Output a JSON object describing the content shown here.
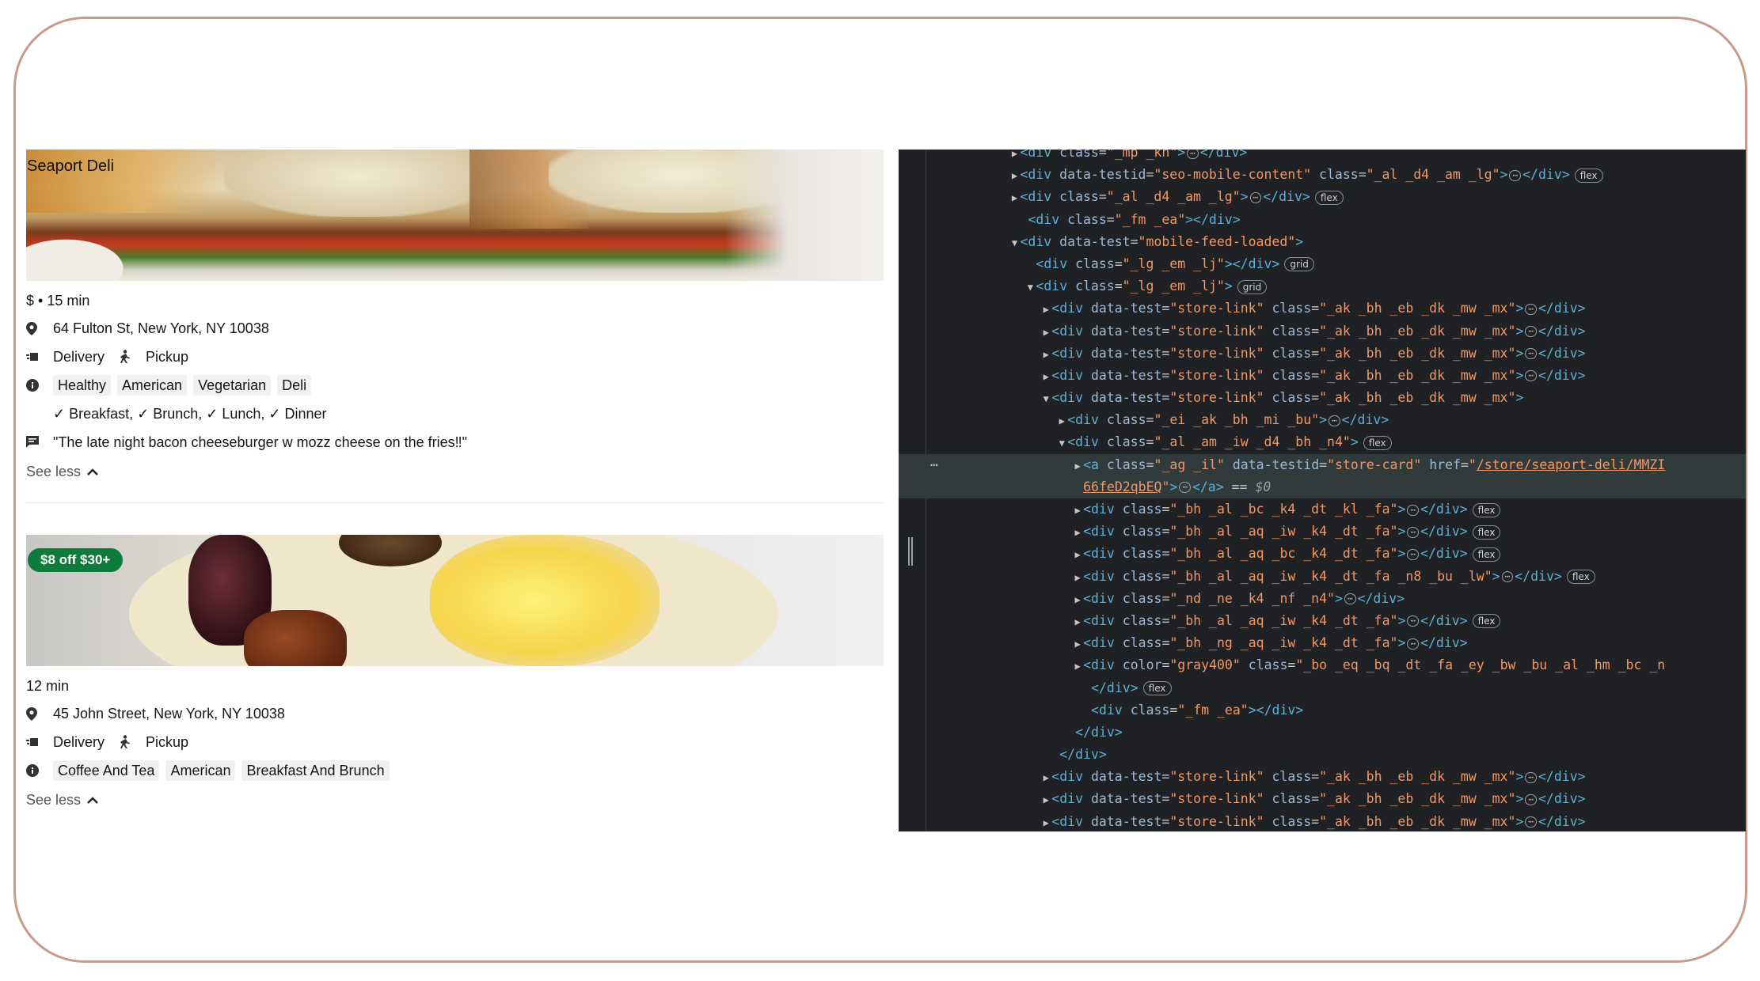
{
  "stores": [
    {
      "hero_title": "Seaport Deli",
      "promo": "",
      "meta": "$ • 15 min",
      "address": "64 Fulton St, New York, NY 10038",
      "delivery_label": "Delivery",
      "pickup_label": "Pickup",
      "tags": [
        "Healthy",
        "American",
        "Vegetarian",
        "Deli"
      ],
      "meals": "✓ Breakfast, ✓ Brunch, ✓ Lunch, ✓ Dinner",
      "review": "\"The late night bacon cheeseburger w mozz cheese on the fries‼\"",
      "see_less": "See less"
    },
    {
      "hero_title": "",
      "promo": "$8 off $30+",
      "meta": "12 min",
      "address": "45 John Street, New York, NY 10038",
      "delivery_label": "Delivery",
      "pickup_label": "Pickup",
      "tags": [
        "Coffee And Tea",
        "American",
        "Breakfast And Brunch"
      ],
      "see_less": "See less"
    }
  ],
  "devtools": {
    "lines": [
      {
        "indent": 10,
        "toggle": "▶",
        "parts": [
          [
            "tag",
            "<div "
          ],
          [
            "an",
            "class"
          ],
          [
            "eq",
            "="
          ],
          [
            "av",
            "\"_mp _kn\""
          ],
          [
            "tag",
            ">"
          ],
          [
            "ell",
            "⋯"
          ],
          [
            "tag",
            "</div>"
          ]
        ]
      },
      {
        "indent": 10,
        "toggle": "▶",
        "parts": [
          [
            "tag",
            "<div "
          ],
          [
            "an",
            "data-testid"
          ],
          [
            "eq",
            "="
          ],
          [
            "av",
            "\"seo-mobile-content\""
          ],
          [
            "tag",
            " "
          ],
          [
            "an",
            "class"
          ],
          [
            "eq",
            "="
          ],
          [
            "av",
            "\"_al _d4 _am _lg\""
          ],
          [
            "tag",
            ">"
          ],
          [
            "ell",
            "⋯"
          ],
          [
            "tag",
            "</div>"
          ]
        ],
        "badge": "flex"
      },
      {
        "indent": 10,
        "toggle": "▶",
        "parts": [
          [
            "tag",
            "<div "
          ],
          [
            "an",
            "class"
          ],
          [
            "eq",
            "="
          ],
          [
            "av",
            "\"_al _d4 _am _lg\""
          ],
          [
            "tag",
            ">"
          ],
          [
            "ell",
            "⋯"
          ],
          [
            "tag",
            "</div>"
          ]
        ],
        "badge": "flex"
      },
      {
        "indent": 11,
        "toggle": "",
        "parts": [
          [
            "tag",
            "<div "
          ],
          [
            "an",
            "class"
          ],
          [
            "eq",
            "="
          ],
          [
            "av",
            "\"_fm _ea\""
          ],
          [
            "tag",
            "></div>"
          ]
        ]
      },
      {
        "indent": 10,
        "toggle": "▼",
        "parts": [
          [
            "tag",
            "<div "
          ],
          [
            "an",
            "data-test"
          ],
          [
            "eq",
            "="
          ],
          [
            "av",
            "\"mobile-feed-loaded\""
          ],
          [
            "tag",
            ">"
          ]
        ]
      },
      {
        "indent": 12,
        "toggle": "",
        "parts": [
          [
            "tag",
            "<div "
          ],
          [
            "an",
            "class"
          ],
          [
            "eq",
            "="
          ],
          [
            "av",
            "\"_lg _em _lj\""
          ],
          [
            "tag",
            "></div>"
          ]
        ],
        "badge": "grid"
      },
      {
        "indent": 12,
        "toggle": "▼",
        "parts": [
          [
            "tag",
            "<div "
          ],
          [
            "an",
            "class"
          ],
          [
            "eq",
            "="
          ],
          [
            "av",
            "\"_lg _em _lj\""
          ],
          [
            "tag",
            ">"
          ]
        ],
        "badge": "grid"
      },
      {
        "indent": 14,
        "toggle": "▶",
        "parts": [
          [
            "tag",
            "<div "
          ],
          [
            "an",
            "data-test"
          ],
          [
            "eq",
            "="
          ],
          [
            "av",
            "\"store-link\""
          ],
          [
            "tag",
            " "
          ],
          [
            "an",
            "class"
          ],
          [
            "eq",
            "="
          ],
          [
            "av",
            "\"_ak _bh _eb _dk _mw _mx\""
          ],
          [
            "tag",
            ">"
          ],
          [
            "ell",
            "⋯"
          ],
          [
            "tag",
            "</div>"
          ]
        ]
      },
      {
        "indent": 14,
        "toggle": "▶",
        "parts": [
          [
            "tag",
            "<div "
          ],
          [
            "an",
            "data-test"
          ],
          [
            "eq",
            "="
          ],
          [
            "av",
            "\"store-link\""
          ],
          [
            "tag",
            " "
          ],
          [
            "an",
            "class"
          ],
          [
            "eq",
            "="
          ],
          [
            "av",
            "\"_ak _bh _eb _dk _mw _mx\""
          ],
          [
            "tag",
            ">"
          ],
          [
            "ell",
            "⋯"
          ],
          [
            "tag",
            "</div>"
          ]
        ]
      },
      {
        "indent": 14,
        "toggle": "▶",
        "parts": [
          [
            "tag",
            "<div "
          ],
          [
            "an",
            "data-test"
          ],
          [
            "eq",
            "="
          ],
          [
            "av",
            "\"store-link\""
          ],
          [
            "tag",
            " "
          ],
          [
            "an",
            "class"
          ],
          [
            "eq",
            "="
          ],
          [
            "av",
            "\"_ak _bh _eb _dk _mw _mx\""
          ],
          [
            "tag",
            ">"
          ],
          [
            "ell",
            "⋯"
          ],
          [
            "tag",
            "</div>"
          ]
        ]
      },
      {
        "indent": 14,
        "toggle": "▶",
        "parts": [
          [
            "tag",
            "<div "
          ],
          [
            "an",
            "data-test"
          ],
          [
            "eq",
            "="
          ],
          [
            "av",
            "\"store-link\""
          ],
          [
            "tag",
            " "
          ],
          [
            "an",
            "class"
          ],
          [
            "eq",
            "="
          ],
          [
            "av",
            "\"_ak _bh _eb _dk _mw _mx\""
          ],
          [
            "tag",
            ">"
          ],
          [
            "ell",
            "⋯"
          ],
          [
            "tag",
            "</div>"
          ]
        ]
      },
      {
        "indent": 14,
        "toggle": "▼",
        "parts": [
          [
            "tag",
            "<div "
          ],
          [
            "an",
            "data-test"
          ],
          [
            "eq",
            "="
          ],
          [
            "av",
            "\"store-link\""
          ],
          [
            "tag",
            " "
          ],
          [
            "an",
            "class"
          ],
          [
            "eq",
            "="
          ],
          [
            "av",
            "\"_ak _bh _eb _dk _mw _mx\""
          ],
          [
            "tag",
            ">"
          ]
        ]
      },
      {
        "indent": 16,
        "toggle": "▶",
        "parts": [
          [
            "tag",
            "<div "
          ],
          [
            "an",
            "class"
          ],
          [
            "eq",
            "="
          ],
          [
            "av",
            "\"_ei _ak _bh _mi _bu\""
          ],
          [
            "tag",
            ">"
          ],
          [
            "ell",
            "⋯"
          ],
          [
            "tag",
            "</div>"
          ]
        ]
      },
      {
        "indent": 16,
        "toggle": "▼",
        "parts": [
          [
            "tag",
            "<div "
          ],
          [
            "an",
            "class"
          ],
          [
            "eq",
            "="
          ],
          [
            "av",
            "\"_al _am _iw _d4 _bh _n4\""
          ],
          [
            "tag",
            ">"
          ]
        ],
        "badge": "flex"
      },
      {
        "indent": 18,
        "toggle": "▶",
        "selected": true,
        "parts": [
          [
            "tag",
            "<a "
          ],
          [
            "an",
            "class"
          ],
          [
            "eq",
            "="
          ],
          [
            "av",
            "\"_ag _il\""
          ],
          [
            "tag",
            " "
          ],
          [
            "an",
            "data-testid"
          ],
          [
            "eq",
            "="
          ],
          [
            "av",
            "\"store-card\""
          ],
          [
            "tag",
            " "
          ],
          [
            "an",
            "href"
          ],
          [
            "eq",
            "="
          ],
          [
            "av",
            "\""
          ],
          [
            "ak",
            "/store/seaport-deli/MMZI"
          ]
        ]
      },
      {
        "indent": 18,
        "toggle": "",
        "selected": true,
        "parts": [
          [
            "ak",
            "66feD2qbEQ"
          ],
          [
            "av",
            "\""
          ],
          [
            "tag",
            ">"
          ],
          [
            "ell",
            "⋯"
          ],
          [
            "tag",
            "</a>"
          ],
          [
            "eq",
            " == "
          ],
          [
            "dollar",
            "$0"
          ]
        ]
      },
      {
        "indent": 18,
        "toggle": "▶",
        "parts": [
          [
            "tag",
            "<div "
          ],
          [
            "an",
            "class"
          ],
          [
            "eq",
            "="
          ],
          [
            "av",
            "\"_bh _al _bc _k4 _dt _kl _fa\""
          ],
          [
            "tag",
            ">"
          ],
          [
            "ell",
            "⋯"
          ],
          [
            "tag",
            "</div>"
          ]
        ],
        "badge": "flex"
      },
      {
        "indent": 18,
        "toggle": "▶",
        "parts": [
          [
            "tag",
            "<div "
          ],
          [
            "an",
            "class"
          ],
          [
            "eq",
            "="
          ],
          [
            "av",
            "\"_bh _al _aq _iw _k4 _dt _fa\""
          ],
          [
            "tag",
            ">"
          ],
          [
            "ell",
            "⋯"
          ],
          [
            "tag",
            "</div>"
          ]
        ],
        "badge": "flex"
      },
      {
        "indent": 18,
        "toggle": "▶",
        "parts": [
          [
            "tag",
            "<div "
          ],
          [
            "an",
            "class"
          ],
          [
            "eq",
            "="
          ],
          [
            "av",
            "\"_bh _al _aq _bc _k4 _dt _fa\""
          ],
          [
            "tag",
            ">"
          ],
          [
            "ell",
            "⋯"
          ],
          [
            "tag",
            "</div>"
          ]
        ],
        "badge": "flex"
      },
      {
        "indent": 18,
        "toggle": "▶",
        "parts": [
          [
            "tag",
            "<div "
          ],
          [
            "an",
            "class"
          ],
          [
            "eq",
            "="
          ],
          [
            "av",
            "\"_bh _al _aq _iw _k4 _dt _fa _n8 _bu _lw\""
          ],
          [
            "tag",
            ">"
          ],
          [
            "ell",
            "⋯"
          ],
          [
            "tag",
            "</div>"
          ]
        ],
        "badge": "flex"
      },
      {
        "indent": 18,
        "toggle": "▶",
        "parts": [
          [
            "tag",
            "<div "
          ],
          [
            "an",
            "class"
          ],
          [
            "eq",
            "="
          ],
          [
            "av",
            "\"_nd _ne _k4 _nf _n4\""
          ],
          [
            "tag",
            ">"
          ],
          [
            "ell",
            "⋯"
          ],
          [
            "tag",
            "</div>"
          ]
        ]
      },
      {
        "indent": 18,
        "toggle": "▶",
        "parts": [
          [
            "tag",
            "<div "
          ],
          [
            "an",
            "class"
          ],
          [
            "eq",
            "="
          ],
          [
            "av",
            "\"_bh _al _aq _iw _k4 _dt _fa\""
          ],
          [
            "tag",
            ">"
          ],
          [
            "ell",
            "⋯"
          ],
          [
            "tag",
            "</div>"
          ]
        ],
        "badge": "flex"
      },
      {
        "indent": 18,
        "toggle": "▶",
        "parts": [
          [
            "tag",
            "<div "
          ],
          [
            "an",
            "class"
          ],
          [
            "eq",
            "="
          ],
          [
            "av",
            "\"_bh _ng _aq _iw _k4 _dt _fa\""
          ],
          [
            "tag",
            ">"
          ],
          [
            "ell",
            "⋯"
          ],
          [
            "tag",
            "</div>"
          ]
        ]
      },
      {
        "indent": 18,
        "toggle": "▶",
        "parts": [
          [
            "tag",
            "<div "
          ],
          [
            "an",
            "color"
          ],
          [
            "eq",
            "="
          ],
          [
            "av",
            "\"gray400\""
          ],
          [
            "tag",
            " "
          ],
          [
            "an",
            "class"
          ],
          [
            "eq",
            "="
          ],
          [
            "av",
            "\"_bo _eq _bq _dt _fa _ey _bw _bu _al _hm _bc _n"
          ]
        ]
      },
      {
        "indent": 19,
        "toggle": "",
        "parts": [
          [
            "tag",
            "</div>"
          ]
        ],
        "badge": "flex"
      },
      {
        "indent": 19,
        "toggle": "",
        "parts": [
          [
            "tag",
            "<div "
          ],
          [
            "an",
            "class"
          ],
          [
            "eq",
            "="
          ],
          [
            "av",
            "\"_fm _ea\""
          ],
          [
            "tag",
            "></div>"
          ]
        ]
      },
      {
        "indent": 17,
        "toggle": "",
        "parts": [
          [
            "tag",
            "</div>"
          ]
        ]
      },
      {
        "indent": 15,
        "toggle": "",
        "parts": [
          [
            "tag",
            "</div>"
          ]
        ]
      },
      {
        "indent": 14,
        "toggle": "▶",
        "parts": [
          [
            "tag",
            "<div "
          ],
          [
            "an",
            "data-test"
          ],
          [
            "eq",
            "="
          ],
          [
            "av",
            "\"store-link\""
          ],
          [
            "tag",
            " "
          ],
          [
            "an",
            "class"
          ],
          [
            "eq",
            "="
          ],
          [
            "av",
            "\"_ak _bh _eb _dk _mw _mx\""
          ],
          [
            "tag",
            ">"
          ],
          [
            "ell",
            "⋯"
          ],
          [
            "tag",
            "</div>"
          ]
        ]
      },
      {
        "indent": 14,
        "toggle": "▶",
        "parts": [
          [
            "tag",
            "<div "
          ],
          [
            "an",
            "data-test"
          ],
          [
            "eq",
            "="
          ],
          [
            "av",
            "\"store-link\""
          ],
          [
            "tag",
            " "
          ],
          [
            "an",
            "class"
          ],
          [
            "eq",
            "="
          ],
          [
            "av",
            "\"_ak _bh _eb _dk _mw _mx\""
          ],
          [
            "tag",
            ">"
          ],
          [
            "ell",
            "⋯"
          ],
          [
            "tag",
            "</div>"
          ]
        ]
      },
      {
        "indent": 14,
        "toggle": "▶",
        "parts": [
          [
            "tag",
            "<div "
          ],
          [
            "an",
            "data-test"
          ],
          [
            "eq",
            "="
          ],
          [
            "av",
            "\"store-link\""
          ],
          [
            "tag",
            " "
          ],
          [
            "an",
            "class"
          ],
          [
            "eq",
            "="
          ],
          [
            "av",
            "\"_ak _bh _eb _dk _mw _mx\""
          ],
          [
            "tag",
            ">"
          ],
          [
            "ell",
            "⋯"
          ],
          [
            "tag",
            "</div>"
          ]
        ]
      }
    ],
    "selected_marker": "⋯"
  }
}
